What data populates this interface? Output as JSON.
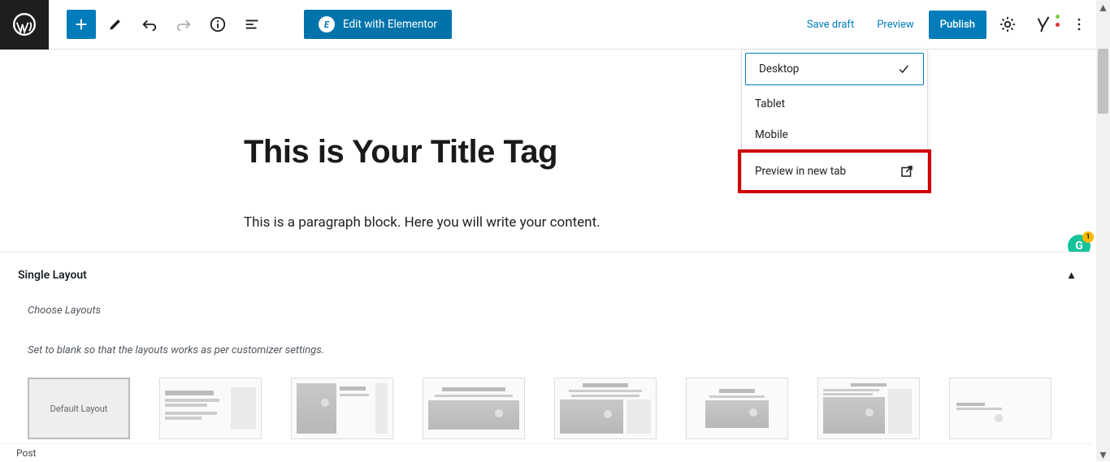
{
  "toolbar": {
    "edit_elementor": "Edit with Elementor"
  },
  "actions": {
    "save_draft": "Save draft",
    "preview": "Preview",
    "publish": "Publish"
  },
  "preview_menu": {
    "items": [
      "Desktop",
      "Tablet",
      "Mobile"
    ],
    "new_tab": "Preview in new tab"
  },
  "editor": {
    "title": "This is Your Title Tag",
    "paragraph": "This is a paragraph block.  Here you will write your content."
  },
  "metabox": {
    "heading": "Single Layout",
    "choose": "Choose Layouts",
    "desc": "Set to blank so that the layouts works as per customizer settings.",
    "default_label": "Default Layout"
  },
  "footer": {
    "label": "Post"
  }
}
